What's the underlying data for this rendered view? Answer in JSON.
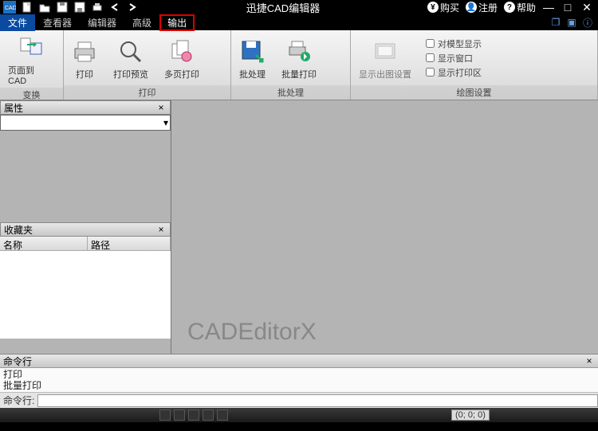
{
  "titlebar": {
    "title": "迅捷CAD编辑器",
    "buy": "购买",
    "register": "注册",
    "help": "帮助"
  },
  "menubar": {
    "file": "文件",
    "viewer": "查看器",
    "editor": "编辑器",
    "advanced": "高级",
    "output": "输出"
  },
  "ribbon": {
    "convert": {
      "title": "变换",
      "page_to_cad": "页面到 CAD"
    },
    "print": {
      "title": "打印",
      "print": "打印",
      "preview": "打印预览",
      "multipage": "多页打印"
    },
    "batch": {
      "title": "批处理",
      "batch": "批处理",
      "batch_print": "批量打印"
    },
    "plot": {
      "title": "绘图设置",
      "show_setting": "显示出图设置",
      "chk_model": "对模型显示",
      "chk_window": "显示窗口",
      "chk_area": "显示打印区"
    }
  },
  "panels": {
    "properties": "属性",
    "favorites": "收藏夹",
    "name_col": "名称",
    "path_col": "路径"
  },
  "canvas": {
    "watermark": "CADEditorX"
  },
  "cmdline": {
    "header": "命令行",
    "log1": "打印",
    "log2": "批量打印",
    "label": "命令行:"
  },
  "status": {
    "coord": "(0; 0; 0)"
  }
}
